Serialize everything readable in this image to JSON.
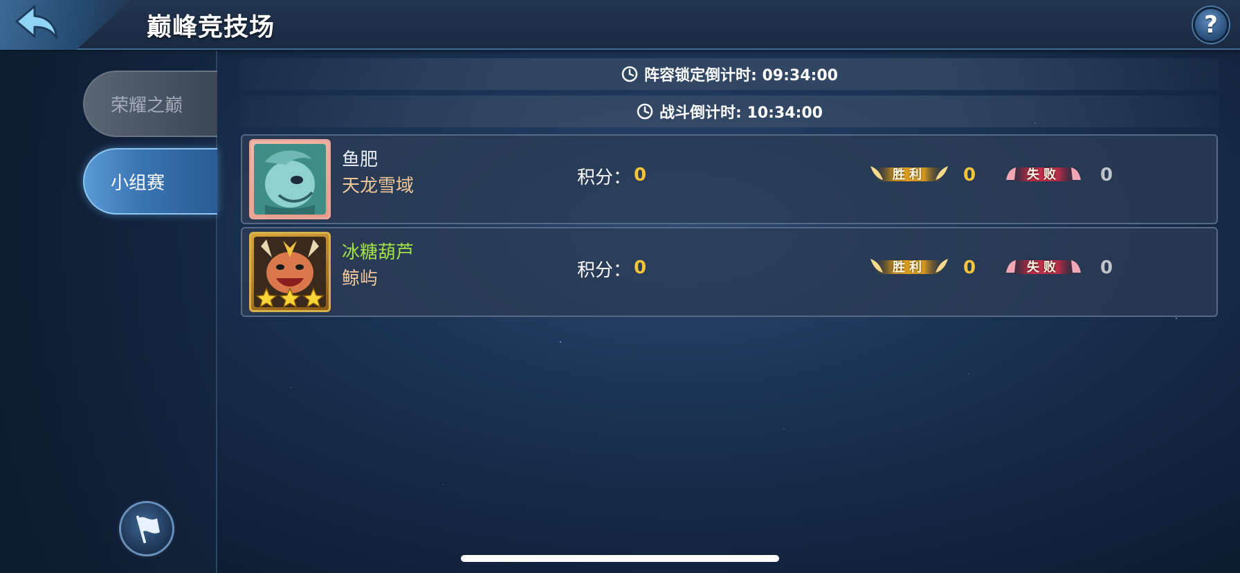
{
  "header": {
    "title": "巅峰竞技场",
    "help_label": "?"
  },
  "sidebar": {
    "tabs": [
      {
        "label": "荣耀之巅",
        "active": false
      },
      {
        "label": "小组赛",
        "active": true
      }
    ]
  },
  "timers": {
    "lineup_lock": "阵容锁定倒计时: 09:34:00",
    "battle": "战斗倒计时: 10:34:00"
  },
  "labels": {
    "score": "积分：",
    "win": "胜利",
    "lose": "失败"
  },
  "players": [
    {
      "name": "鱼肥",
      "name_color": "#ffffff",
      "server": "天龙雪域",
      "score": "0",
      "wins": "0",
      "losses": "0"
    },
    {
      "name": "冰糖葫芦",
      "name_color": "#a4e04a",
      "server": "鲸屿",
      "score": "0",
      "wins": "0",
      "losses": "0",
      "stars": 3
    }
  ],
  "colors": {
    "accent_gold": "#f5c43a",
    "win_badge": "#e0a020",
    "lose_badge": "#c0304a"
  }
}
